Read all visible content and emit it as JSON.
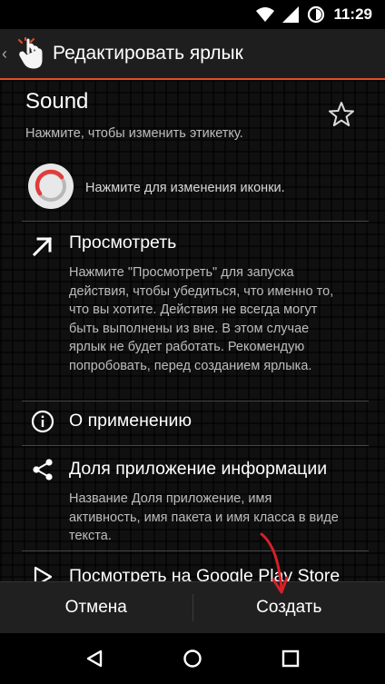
{
  "status_bar": {
    "time": "11:29"
  },
  "app_bar": {
    "back_glyph": "‹",
    "title": "Редактировать ярлык"
  },
  "label": {
    "title": "Sound",
    "hint": "Нажмите, чтобы изменить этикетку."
  },
  "icon_row": {
    "hint": "Нажмите для изменения иконки."
  },
  "items": [
    {
      "icon": "arrow-up-right-icon",
      "title": "Просмотреть",
      "description": "Нажмите \"Просмотреть\" для запуска действия, чтобы убедиться, что именно то, что вы хотите. Действия не всегда могут быть выполнены из вне. В этом случае ярлык не будет работать. Рекомендую попробовать, перед созданием ярлыка."
    },
    {
      "icon": "info-icon",
      "title": "О применению"
    },
    {
      "icon": "share-icon",
      "title": "Доля приложение информации",
      "description": "Название Доля приложение, имя активность, имя пакета и имя класса в виде текста."
    },
    {
      "icon": "play-store-icon",
      "title": "Посмотреть на Google Play Store"
    }
  ],
  "buttons": {
    "cancel": "Отмена",
    "create": "Создать"
  },
  "colors": {
    "accent": "#e2502a",
    "annotation_arrow": "#d8202a"
  }
}
